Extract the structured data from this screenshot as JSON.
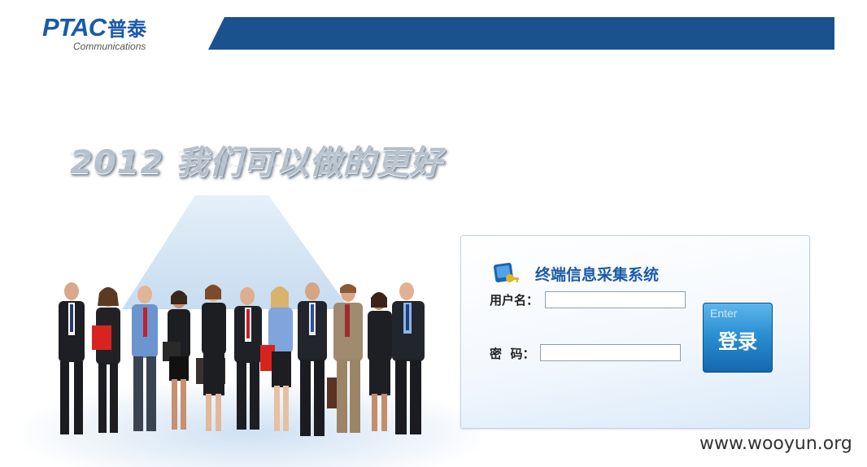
{
  "header": {
    "logo_text": "PTAC",
    "logo_cn": "普泰",
    "logo_subtitle": "Communications"
  },
  "slogan": "2012 我们可以做的更好",
  "login": {
    "title": "终端信息采集系统",
    "username_label": "用户名：",
    "username_value": "",
    "password_label": "密  码：",
    "password_value": "",
    "button_hint": "Enter",
    "button_label": "登录"
  },
  "watermark": "www.wooyun.org",
  "colors": {
    "brand_blue": "#1a5aa8",
    "header_bar": "#1a5290",
    "button_blue": "#2b8fd3"
  },
  "icons": {
    "panel_icon": "key-card-icon"
  }
}
